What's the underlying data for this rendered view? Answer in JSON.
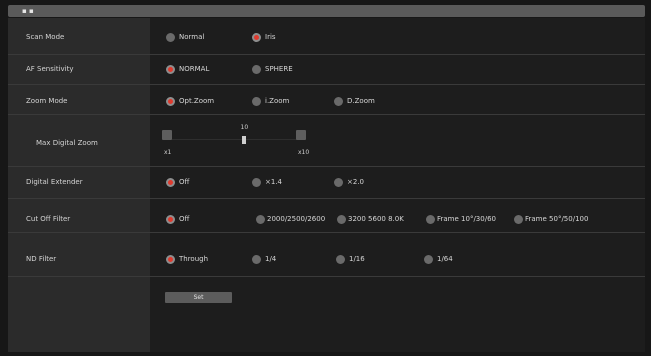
{
  "header": {
    "title": "▪ ▪"
  },
  "rows": [
    {
      "label": "Scan Mode",
      "options": [
        {
          "label": "Normal",
          "selected": false
        },
        {
          "label": "Iris",
          "selected": true
        }
      ]
    },
    {
      "label": "AF Sensitivity",
      "options": [
        {
          "label": "NORMAL",
          "selected": true
        },
        {
          "label": "SPHERE",
          "selected": false
        }
      ]
    },
    {
      "label": "Zoom Mode",
      "options": [
        {
          "label": "Opt.Zoom",
          "selected": true
        },
        {
          "label": "i.Zoom",
          "selected": false
        },
        {
          "label": "D.Zoom",
          "selected": false
        }
      ]
    },
    {
      "label": "Max Digital Zoom"
    },
    {
      "label": "Digital Extender",
      "options": [
        {
          "label": "Off",
          "selected": true
        },
        {
          "label": "×1.4",
          "selected": false
        },
        {
          "label": "×2.0",
          "selected": false
        }
      ]
    },
    {
      "label": "Cut Off Filter",
      "options": [
        {
          "label": "Off",
          "selected": true
        },
        {
          "label": "2000/2500/2600",
          "selected": false
        },
        {
          "label": "3200 5600 8.0K",
          "selected": false
        },
        {
          "label": "Frame 10°/30/60",
          "selected": false
        },
        {
          "label": "Frame 50°/50/100",
          "selected": false
        }
      ]
    },
    {
      "label": "ND Filter",
      "options": [
        {
          "label": "Through",
          "selected": true
        },
        {
          "label": "1/4",
          "selected": false
        },
        {
          "label": "1/16",
          "selected": false
        },
        {
          "label": "1/64",
          "selected": false
        }
      ]
    }
  ],
  "slider": {
    "min_label": "x1",
    "max_label": "x10",
    "value_label": "10",
    "value_fraction": 0.55
  },
  "set_button": {
    "label": "Set"
  },
  "colors": {
    "selected_radio": "#e03a2e",
    "unselected_radio": "#6a6a6a",
    "left_panel": "#2b2b2b",
    "right_panel": "#1d1d1d"
  }
}
